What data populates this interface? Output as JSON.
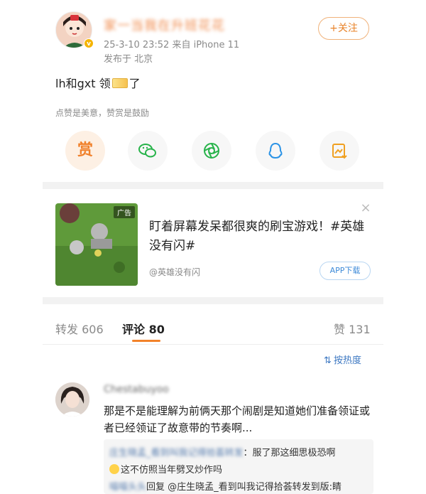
{
  "post": {
    "username": "家一当我在升班花花",
    "meta": "25-3-10 23:52  来自 iPhone 11",
    "location": "发布于 北京",
    "follow_label": "+关注",
    "text_before": "lh和gxt 领",
    "text_after": "了",
    "hint": "点赞是美意，赞赏是鼓励",
    "reward_label": "赏"
  },
  "icons": {
    "wechat": "wechat-icon",
    "moments": "moments-icon",
    "qq": "qq-icon",
    "save_image": "save-image-icon"
  },
  "ad": {
    "tag": "广告",
    "title": "盯着屏幕发呆都很爽的刷宝游戏！#英雄没有闪#",
    "source": "@英雄没有闪",
    "button": "APP下载",
    "close": "×"
  },
  "tabs": {
    "repost": "转发 606",
    "comments": "评论 80",
    "likes": "赞 131"
  },
  "sort": {
    "label": "按热度"
  },
  "comment": {
    "name": "Chestabuyoo",
    "text": "那是不是能理解为前俩天那个闹剧是知道她们准备领证或者已经领证了故意带的节奏啊...",
    "replies": [
      {
        "author": "庄生晓孟_看到叫我记得拾荟转发",
        "text": "服了那这细思极恐啊"
      },
      {
        "author": "",
        "text": "这不仿照当年劈叉炒作吗"
      },
      {
        "author": "喵喵头头",
        "text": "回复 @庄生晓孟_看到叫我记得拾荟转发到版:睛"
      }
    ]
  },
  "colors": {
    "accent": "#f2822a",
    "link": "#3d78c2"
  }
}
